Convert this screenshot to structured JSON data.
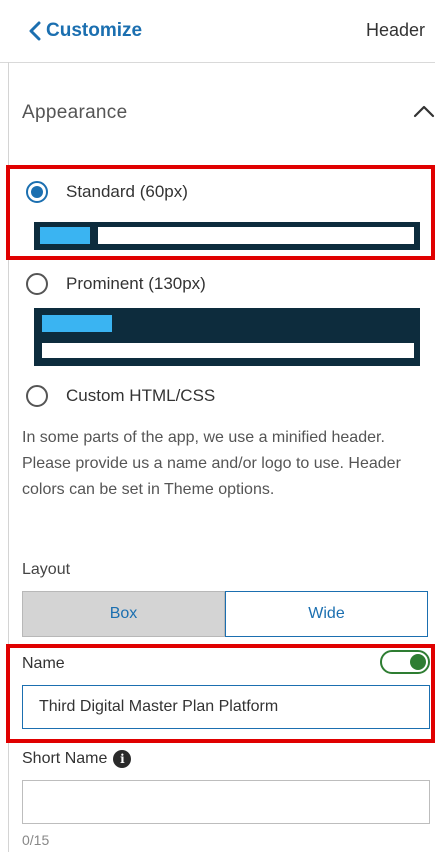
{
  "header": {
    "back_label": "Customize",
    "panel_name": "Header"
  },
  "appearance": {
    "title": "Appearance",
    "options": [
      {
        "label": "Standard (60px)",
        "selected": true
      },
      {
        "label": "Prominent (130px)",
        "selected": false
      },
      {
        "label": "Custom HTML/CSS",
        "selected": false
      }
    ],
    "description": "In some parts of the app, we use a minified header. Please provide us a name and/or logo to use. Header colors can be set in Theme options."
  },
  "layout": {
    "label": "Layout",
    "options": [
      "Box",
      "Wide"
    ],
    "selected": "Box"
  },
  "name": {
    "label": "Name",
    "enabled": true,
    "value": "Third Digital Master Plan Platform"
  },
  "short_name": {
    "label": "Short Name",
    "value": "",
    "counter": "0/15"
  },
  "colors": {
    "accent": "#1b6fb0",
    "preview_bg": "#0d2c3d",
    "preview_accent": "#3ab4f2",
    "highlight": "#e00000",
    "toggle_on": "#2e7d32"
  }
}
